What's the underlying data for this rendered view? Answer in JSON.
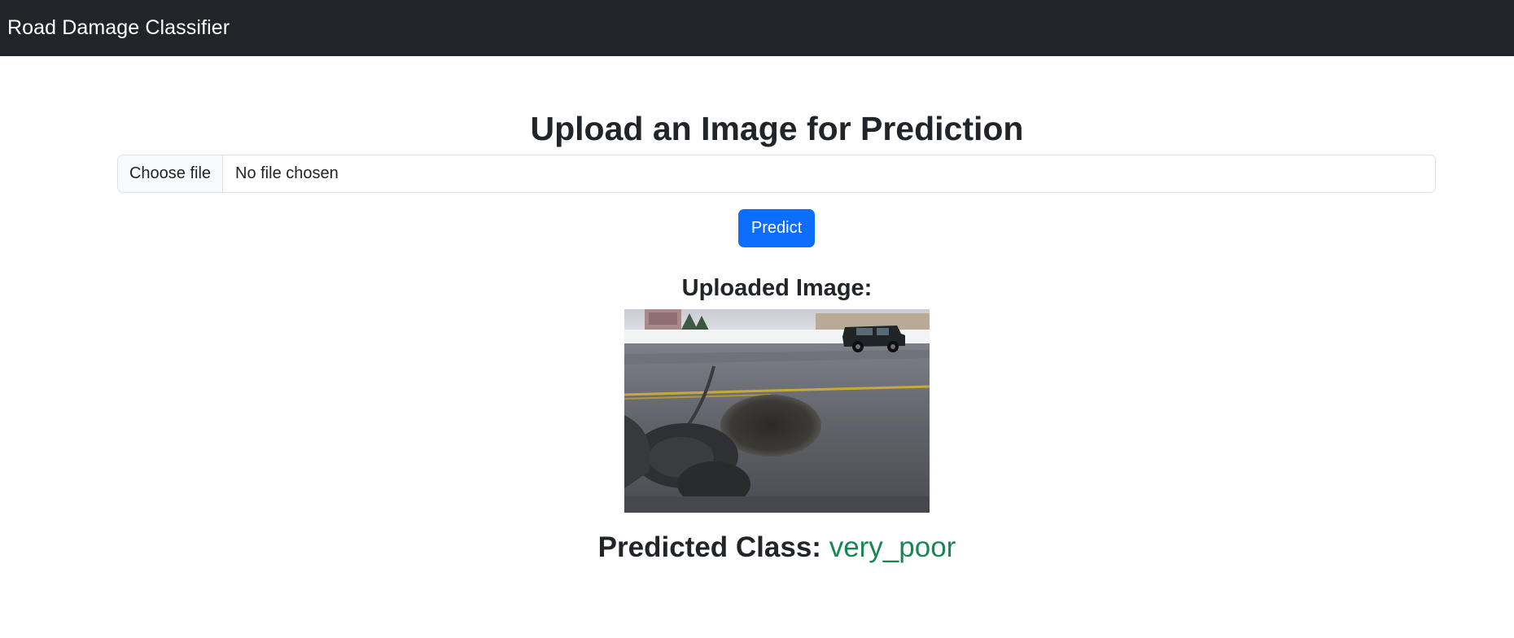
{
  "navbar": {
    "brand": "Road Damage Classifier"
  },
  "main": {
    "title": "Upload an Image for Prediction",
    "file_input": {
      "button_label": "Choose file",
      "status": "No file chosen"
    },
    "predict_label": "Predict",
    "uploaded_heading": "Uploaded Image:",
    "uploaded_image": {
      "alt": "Road with potholes"
    },
    "prediction": {
      "label": "Predicted Class:",
      "value": "very_poor"
    }
  },
  "colors": {
    "navbar_bg": "#212529",
    "primary": "#0d6efd",
    "success": "#198754"
  }
}
